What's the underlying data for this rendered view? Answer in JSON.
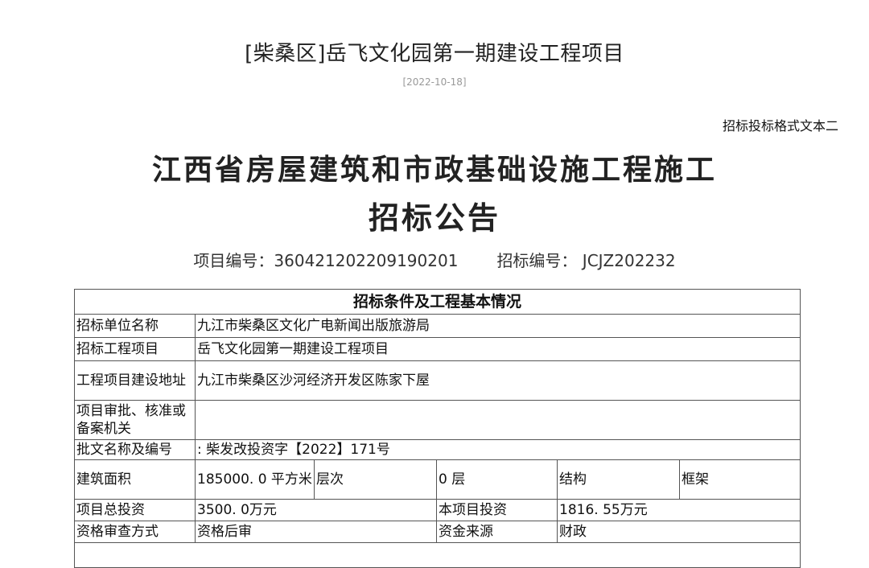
{
  "page": {
    "title": "[柴桑区]岳飞文化园第一期建设工程项目",
    "date": "[2022-10-18]"
  },
  "document": {
    "format_note": "招标投标格式文本二",
    "title_line1": "江西省房屋建筑和市政基础设施工程施工",
    "title_line2": "招标公告",
    "project_code": "项目编号：360421202209190201",
    "tender_code": "招标编号： JCJZ202232"
  },
  "table": {
    "section_title": "招标条件及工程基本情况",
    "tenderer_label": "招标单位名称",
    "tenderer_value": "九江市柴桑区文化广电新闻出版旅游局",
    "project_label": "招标工程项目",
    "project_value": "岳飞文化园第一期建设工程项目",
    "address_label": "工程项目建设地址",
    "address_value": "九江市柴桑区沙河经济开发区陈家下屋",
    "approval_authority_label": "项目审批、核准或备案机关",
    "approval_authority_value": "",
    "approval_doc_label": "批文名称及编号",
    "approval_doc_value": ": 柴发改投资字【2022】171号",
    "area_label": "建筑面积",
    "area_value": "185000. 0 平方米",
    "floors_label": "层次",
    "floors_value": "0 层",
    "structure_label": "结构",
    "structure_value": "框架",
    "total_investment_label": "项目总投资",
    "total_investment_value": "3500. 0万元",
    "this_investment_label": "本项目投资",
    "this_investment_value": "1816. 55万元",
    "qualification_label": "资格审查方式",
    "qualification_value": "资格后审",
    "fund_source_label": "资金来源",
    "fund_source_value": "财政"
  }
}
